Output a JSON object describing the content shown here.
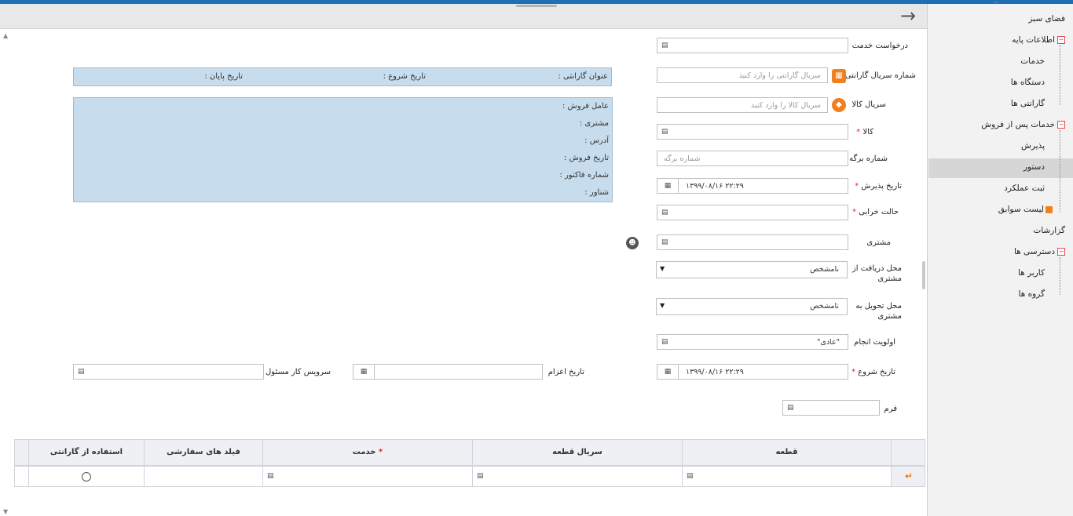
{
  "sidebar": {
    "items": [
      {
        "label": "فضای سبز"
      },
      {
        "label": "اطلاعات پایه"
      },
      {
        "label": "خدمات"
      },
      {
        "label": "دستگاه ها"
      },
      {
        "label": "گارانتی ها"
      },
      {
        "label": "خدمات پس از فروش"
      },
      {
        "label": "پذیرش"
      },
      {
        "label": "دستور"
      },
      {
        "label": "ثبت عملکرد"
      },
      {
        "label": "لیست سوابق"
      },
      {
        "label": "گزارشات"
      },
      {
        "label": "دسترسی ها"
      },
      {
        "label": "کاربر ها"
      },
      {
        "label": "گروه ها"
      }
    ],
    "active": "دستور"
  },
  "form": {
    "service_request": {
      "label": "درخواست خدمت"
    },
    "warranty_serial": {
      "label": "شماره سریال گارانتی",
      "placeholder": "سریال گارانتی را وارد کنید"
    },
    "product_serial": {
      "label": "سریال کالا",
      "placeholder": "سریال کالا را وارد کنید"
    },
    "product": {
      "label": "کالا",
      "required": "*"
    },
    "sheet_number": {
      "label": "شماره برگه",
      "placeholder": "شماره برگه"
    },
    "reception_date": {
      "label": "تاریخ پذیرش",
      "required": "*",
      "value": "۱۳۹۹/۰۸/۱۶ ۲۲:۲۹"
    },
    "fault_state": {
      "label": "حالت خرابی",
      "required": "*"
    },
    "customer": {
      "label": "مشتری"
    },
    "pickup_location": {
      "label": "محل دریافت از مشتری",
      "value": "نامشخص"
    },
    "delivery_location": {
      "label": "محل تحویل به مشتری",
      "value": "نامشخص"
    },
    "priority": {
      "label": "اولویت انجام",
      "value": "\"عادی\""
    },
    "start_date": {
      "label": "تاریخ شروع",
      "required": "*",
      "value": "۱۳۹۹/۰۸/۱۶ ۲۲:۲۹"
    },
    "dispatch_date": {
      "label": "تاریخ اعزام"
    },
    "responsible_serviceman": {
      "label": "سرویس کار مسئول"
    },
    "form_field": {
      "label": "فرم"
    }
  },
  "warranty_panel": {
    "title_label": "عنوان گارانتی :",
    "start_label": "تاریخ شروع :",
    "end_label": "تاریخ پایان :"
  },
  "sale_panel": {
    "lines": [
      "عامل فروش :",
      "مشتری :",
      "آدرس :",
      "تاریخ فروش :",
      "شماره فاکتور :",
      "شناور :"
    ]
  },
  "grid": {
    "columns": [
      {
        "label": "قطعه"
      },
      {
        "label": "سریال قطعه"
      },
      {
        "label": "خدمت",
        "required": "*"
      },
      {
        "label": "فیلد های سفارشی"
      },
      {
        "label": "استفاده از گارانتی"
      }
    ]
  },
  "icons": {
    "back": "arrow-right-icon",
    "lookup": "lookup-icon",
    "calendar": "calendar-icon",
    "enter": "enter-icon"
  },
  "colors": {
    "accent": "#1f6fb5",
    "panel": "#c7ddee",
    "orange": "#f07f1e"
  }
}
